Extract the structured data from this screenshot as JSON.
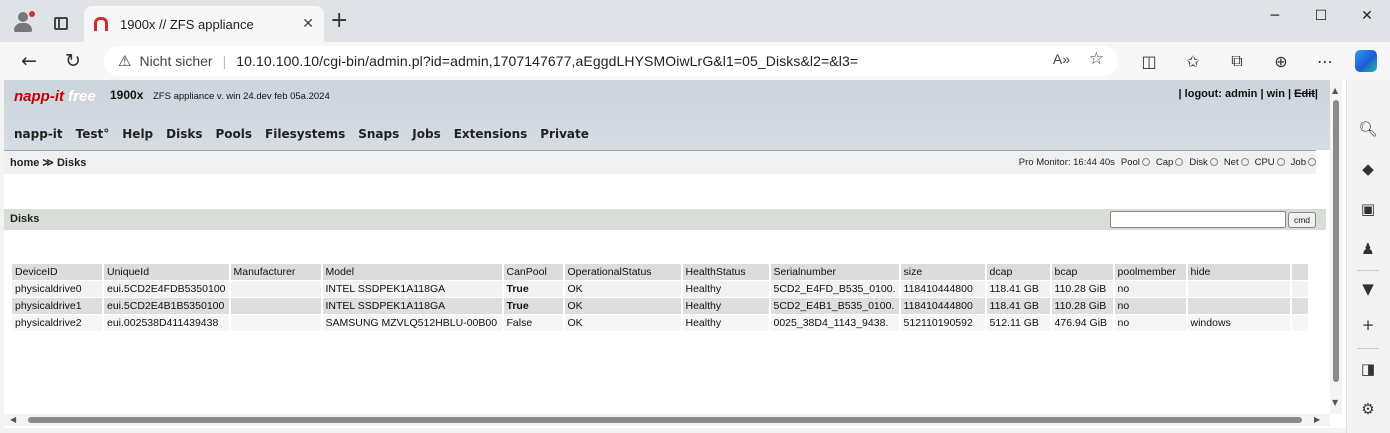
{
  "browser": {
    "tab_title": "1900x // ZFS appliance",
    "security_label": "Nicht sicher",
    "url": "10.10.100.10/cgi-bin/admin.pl?id=admin,1707147677,aEggdLHYSMOiwLrG&l1=05_Disks&l2=&l3=",
    "icons": [
      "profile-icon",
      "tab-actions-icon",
      "back-icon",
      "reload-icon",
      "warning-icon",
      "read-aloud-icon",
      "favorite-icon",
      "split-screen-icon",
      "favorites-icon",
      "collections-icon",
      "more-icon",
      "copilot-icon"
    ]
  },
  "napp": {
    "logo_main": "napp-it",
    "logo_suffix": "free",
    "host": "1900x",
    "version": "ZFS appliance v. win 24.dev feb 05a.2024",
    "top_links": {
      "sep1": "|",
      "logout": "logout: admin",
      "sep2": "|",
      "win": "win",
      "sep3": "|",
      "edit": "Edit",
      "sep4": "|"
    },
    "menu": [
      "napp-it",
      "Test°",
      "Help",
      "Disks",
      "Pools",
      "Filesystems",
      "Snaps",
      "Jobs",
      "Extensions",
      "Private"
    ],
    "breadcrumb": "home ≫ Disks",
    "monitor": {
      "label": "Pro Monitor: 16:44 40s",
      "items": [
        "Pool",
        "Cap",
        "Disk",
        "Net",
        "CPU",
        "Job"
      ]
    },
    "section_title": "Disks",
    "cmd": {
      "value": "",
      "button_label": "cmd"
    }
  },
  "table": {
    "headers": [
      "DeviceID",
      "UniqueId",
      "Manufacturer",
      "Model",
      "CanPool",
      "OperationalStatus",
      "HealthStatus",
      "Serialnumber",
      "size",
      "dcap",
      "bcap",
      "poolmember",
      "hide",
      ""
    ],
    "rows": [
      [
        "physicaldrive0",
        "eui.5CD2E4FDB5350100",
        "",
        "INTEL SSDPEK1A118GA",
        "True",
        "OK",
        "Healthy",
        "5CD2_E4FD_B535_0100.",
        "118410444800",
        "118.41 GB",
        "110.28 GiB",
        "no",
        "",
        ""
      ],
      [
        "physicaldrive1",
        "eui.5CD2E4B1B5350100",
        "",
        "INTEL SSDPEK1A118GA",
        "True",
        "OK",
        "Healthy",
        "5CD2_E4B1_B535_0100.",
        "118410444800",
        "118.41 GB",
        "110.28 GiB",
        "no",
        "",
        ""
      ],
      [
        "physicaldrive2",
        "eui.002538D411439438",
        "",
        "SAMSUNG MZVLQ512HBLU-00B00",
        "False",
        "OK",
        "Healthy",
        "0025_38D4_1143_9438.",
        "512110190592",
        "512.11 GB",
        "476.94 GiB",
        "no",
        "windows",
        ""
      ]
    ]
  }
}
